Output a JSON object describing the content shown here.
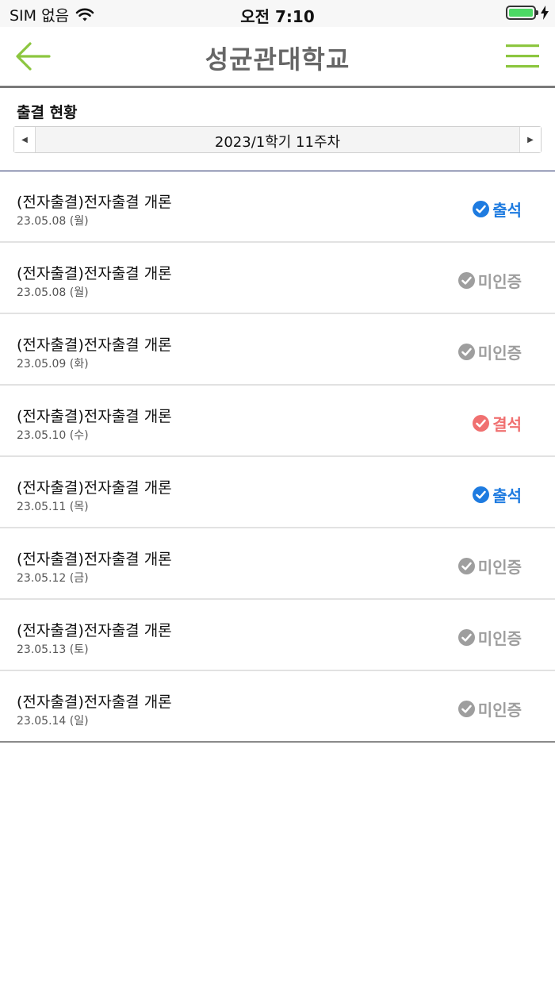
{
  "status_bar": {
    "carrier": "SIM 없음",
    "time": "오전 7:10"
  },
  "nav": {
    "title": "성균관대학교"
  },
  "section": {
    "title": "출결 현황",
    "week_label": "2023/1학기 11주차"
  },
  "colors": {
    "present": "#1e7be0",
    "unverified": "#9e9e9e",
    "absent": "#f07070",
    "accent": "#8cc63f"
  },
  "records": [
    {
      "course": "(전자출결)전자출결 개론",
      "date": "23.05.08 (월)",
      "status": "출석",
      "status_type": "present"
    },
    {
      "course": "(전자출결)전자출결 개론",
      "date": "23.05.08 (월)",
      "status": "미인증",
      "status_type": "unverified"
    },
    {
      "course": "(전자출결)전자출결 개론",
      "date": "23.05.09 (화)",
      "status": "미인증",
      "status_type": "unverified"
    },
    {
      "course": "(전자출결)전자출결 개론",
      "date": "23.05.10 (수)",
      "status": "결석",
      "status_type": "absent"
    },
    {
      "course": "(전자출결)전자출결 개론",
      "date": "23.05.11 (목)",
      "status": "출석",
      "status_type": "present"
    },
    {
      "course": "(전자출결)전자출결 개론",
      "date": "23.05.12 (금)",
      "status": "미인증",
      "status_type": "unverified"
    },
    {
      "course": "(전자출결)전자출결 개론",
      "date": "23.05.13 (토)",
      "status": "미인증",
      "status_type": "unverified"
    },
    {
      "course": "(전자출결)전자출결 개론",
      "date": "23.05.14 (일)",
      "status": "미인증",
      "status_type": "unverified"
    }
  ]
}
